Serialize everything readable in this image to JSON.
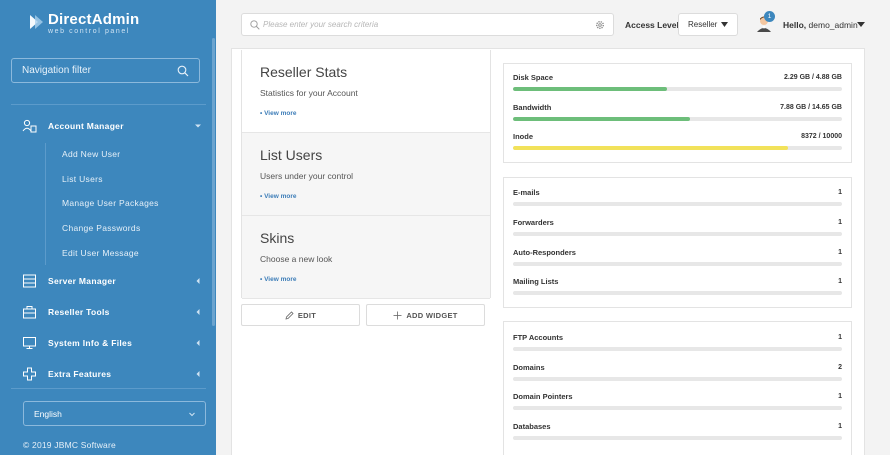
{
  "brand": {
    "title": "DirectAdmin",
    "subtitle": "web control panel"
  },
  "sidebar": {
    "nav_filter": "Navigation filter",
    "menus": [
      {
        "label": "Account Manager"
      },
      {
        "label": "Server Manager"
      },
      {
        "label": "Reseller Tools"
      },
      {
        "label": "System Info & Files"
      },
      {
        "label": "Extra Features"
      }
    ],
    "account_items": [
      "Add New User",
      "List Users",
      "Manage User Packages",
      "Change Passwords",
      "Edit User Message"
    ],
    "language": "English",
    "copyright": "© 2019 JBMC Software"
  },
  "topbar": {
    "search_placeholder": "Please enter your search criteria",
    "access_label": "Access Level",
    "access_value": "Reseller",
    "notification_count": "1",
    "hello_prefix": "Hello,",
    "username": "demo_admin"
  },
  "widgets": [
    {
      "title": "Reseller Stats",
      "desc": "Statistics for your Account",
      "more": "• View more"
    },
    {
      "title": "List Users",
      "desc": "Users under your control",
      "more": "• View more"
    },
    {
      "title": "Skins",
      "desc": "Choose a new look",
      "more": "• View more"
    }
  ],
  "buttons": {
    "edit": "EDIT",
    "add_widget": "ADD WIDGET"
  },
  "usage": [
    {
      "label": "Disk Space",
      "value": "2.29 GB / 4.88 GB",
      "fraction": 0.469,
      "color": "#6dbe7a"
    },
    {
      "label": "Bandwidth",
      "value": "7.88 GB / 14.65 GB",
      "fraction": 0.538,
      "color": "#6dbe7a"
    },
    {
      "label": "Inode",
      "value": "8372 / 10000",
      "fraction": 0.837,
      "color": "#f2e25a"
    }
  ],
  "mail": [
    {
      "label": "E-mails",
      "value": "1"
    },
    {
      "label": "Forwarders",
      "value": "1"
    },
    {
      "label": "Auto-Responders",
      "value": "1"
    },
    {
      "label": "Mailing Lists",
      "value": "1"
    }
  ],
  "web": [
    {
      "label": "FTP Accounts",
      "value": "1"
    },
    {
      "label": "Domains",
      "value": "2"
    },
    {
      "label": "Domain Pointers",
      "value": "1"
    },
    {
      "label": "Databases",
      "value": "1"
    }
  ],
  "colors": {
    "sidebar": "#3d87bd",
    "accent": "#3d7db8",
    "green": "#6dbe7a",
    "yellow": "#f2e25a"
  }
}
